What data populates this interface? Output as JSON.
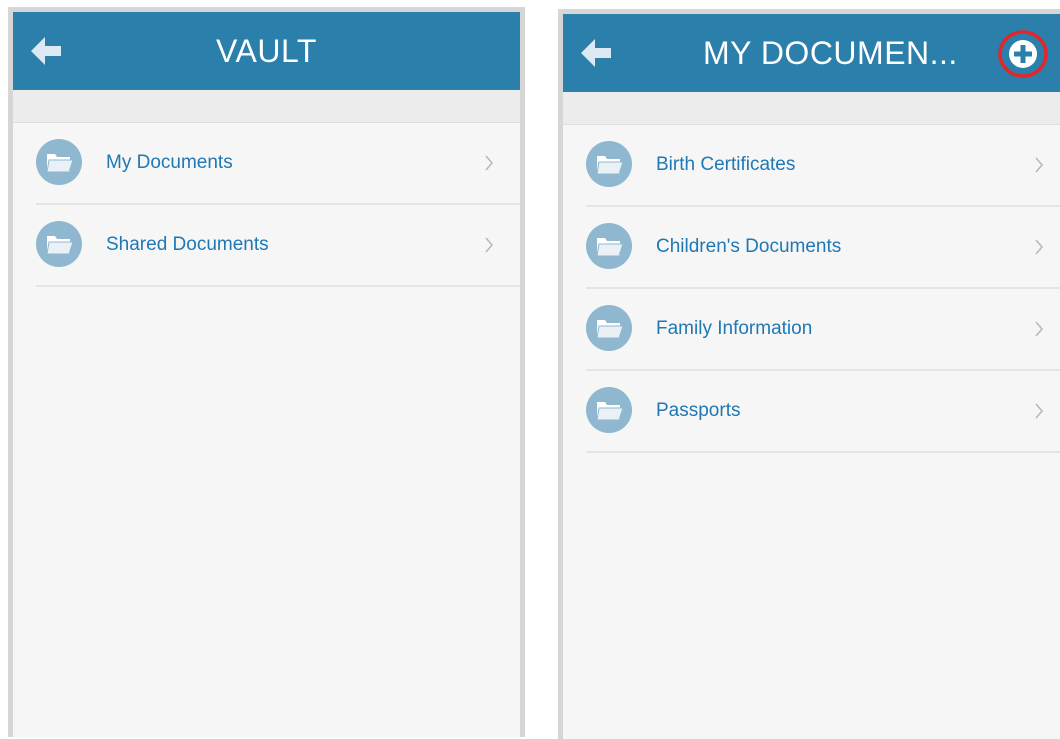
{
  "vault_screen": {
    "title": "VAULT",
    "back_icon": "arrow-left-icon",
    "items": [
      {
        "label": "My Documents",
        "icon": "folder-icon"
      },
      {
        "label": "Shared Documents",
        "icon": "folder-icon"
      }
    ]
  },
  "my_documents_screen": {
    "title": "MY DOCUMEN...",
    "back_icon": "arrow-left-icon",
    "add_icon": "plus-circle-icon",
    "items": [
      {
        "label": "Birth Certificates",
        "icon": "folder-icon"
      },
      {
        "label": "Children's Documents",
        "icon": "folder-icon"
      },
      {
        "label": "Family Information",
        "icon": "folder-icon"
      },
      {
        "label": "Passports",
        "icon": "folder-icon"
      }
    ]
  },
  "colors": {
    "navbar": "#2a7fab",
    "link_text": "#1f78b4",
    "folder_icon": "#8fb7d0",
    "highlight_ring": "#e3262a"
  }
}
